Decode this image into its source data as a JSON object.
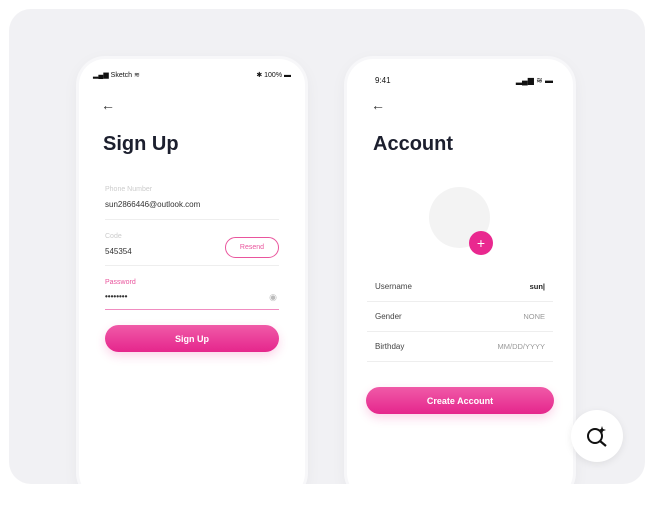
{
  "signup": {
    "status_left": "Sketch",
    "status_right": "100%",
    "title": "Sign Up",
    "phone_label": "Phone Number",
    "phone_value": "sun2866446@outlook.com",
    "code_label": "Code",
    "code_value": "545354",
    "resend": "Resend",
    "password_label": "Password",
    "password_value": "••••••••",
    "button": "Sign Up"
  },
  "account": {
    "time": "9:41",
    "title": "Account",
    "rows": [
      {
        "label": "Username",
        "value": "sun|"
      },
      {
        "label": "Gender",
        "value": "NONE"
      },
      {
        "label": "Birthday",
        "value": "MM/DD/YYYY"
      }
    ],
    "button": "Create Account"
  },
  "colors": {
    "accent": "#e9288f"
  }
}
